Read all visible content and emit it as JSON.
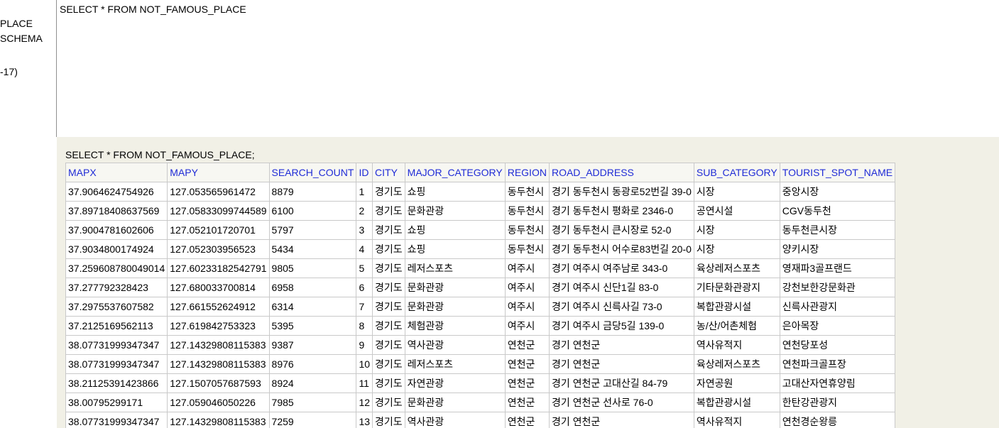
{
  "sidebar": {
    "items": [
      "PLACE",
      "SCHEMA",
      "-17)"
    ]
  },
  "editor": {
    "query": "SELECT * FROM NOT_FAMOUS_PLACE"
  },
  "results": {
    "query_echo": "SELECT * FROM NOT_FAMOUS_PLACE;",
    "columns": [
      "MAPX",
      "MAPY",
      "SEARCH_COUNT",
      "ID",
      "CITY",
      "MAJOR_CATEGORY",
      "REGION",
      "ROAD_ADDRESS",
      "SUB_CATEGORY",
      "TOURIST_SPOT_NAME"
    ],
    "rows": [
      [
        "37.9064624754926",
        "127.053565961472",
        "8879",
        "1",
        "경기도",
        "쇼핑",
        "동두천시",
        "경기 동두천시 동광로52번길 39-0",
        "시장",
        "중앙시장"
      ],
      [
        "37.89718408637569",
        "127.05833099744589",
        "6100",
        "2",
        "경기도",
        "문화관광",
        "동두천시",
        "경기 동두천시 평화로 2346-0",
        "공연시설",
        "CGV동두천"
      ],
      [
        "37.9004781602606",
        "127.052101720701",
        "5797",
        "3",
        "경기도",
        "쇼핑",
        "동두천시",
        "경기 동두천시 큰시장로 52-0",
        "시장",
        "동두천큰시장"
      ],
      [
        "37.9034800174924",
        "127.052303956523",
        "5434",
        "4",
        "경기도",
        "쇼핑",
        "동두천시",
        "경기 동두천시 어수로83번길 20-0",
        "시장",
        "양키시장"
      ],
      [
        "37.259608780049014",
        "127.60233182542791",
        "9805",
        "5",
        "경기도",
        "레저스포츠",
        "여주시",
        "경기 여주시 여주남로 343-0",
        "육상레저스포츠",
        "영재파3골프랜드"
      ],
      [
        "37.277792328423",
        "127.680033700814",
        "6958",
        "6",
        "경기도",
        "문화관광",
        "여주시",
        "경기 여주시 신단1길 83-0",
        "기타문화관광지",
        "강천보한강문화관"
      ],
      [
        "37.2975537607582",
        "127.661552624912",
        "6314",
        "7",
        "경기도",
        "문화관광",
        "여주시",
        "경기 여주시 신륵사길 73-0",
        "복합관광시설",
        "신륵사관광지"
      ],
      [
        "37.2125169562113",
        "127.619842753323",
        "5395",
        "8",
        "경기도",
        "체험관광",
        "여주시",
        "경기 여주시 금당5길 139-0",
        "농/산/어촌체험",
        "은아목장"
      ],
      [
        "38.07731999347347",
        "127.14329808115383",
        "9387",
        "9",
        "경기도",
        "역사관광",
        "연천군",
        "경기 연천군",
        "역사유적지",
        "연천당포성"
      ],
      [
        "38.07731999347347",
        "127.14329808115383",
        "8976",
        "10",
        "경기도",
        "레저스포츠",
        "연천군",
        "경기 연천군",
        "육상레저스포츠",
        "연천파크골프장"
      ],
      [
        "38.21125391423866",
        "127.1507057687593",
        "8924",
        "11",
        "경기도",
        "자연관광",
        "연천군",
        "경기 연천군 고대산길 84-79",
        "자연공원",
        "고대산자연휴양림"
      ],
      [
        "38.00795299171",
        "127.059046050226",
        "7985",
        "12",
        "경기도",
        "문화관광",
        "연천군",
        "경기 연천군 선사로 76-0",
        "복합관광시설",
        "한탄강관광지"
      ],
      [
        "38.07731999347347",
        "127.14329808115383",
        "7259",
        "13",
        "경기도",
        "역사관광",
        "연천군",
        "경기 연천군",
        "역사유적지",
        "연천경순왕릉"
      ]
    ]
  }
}
